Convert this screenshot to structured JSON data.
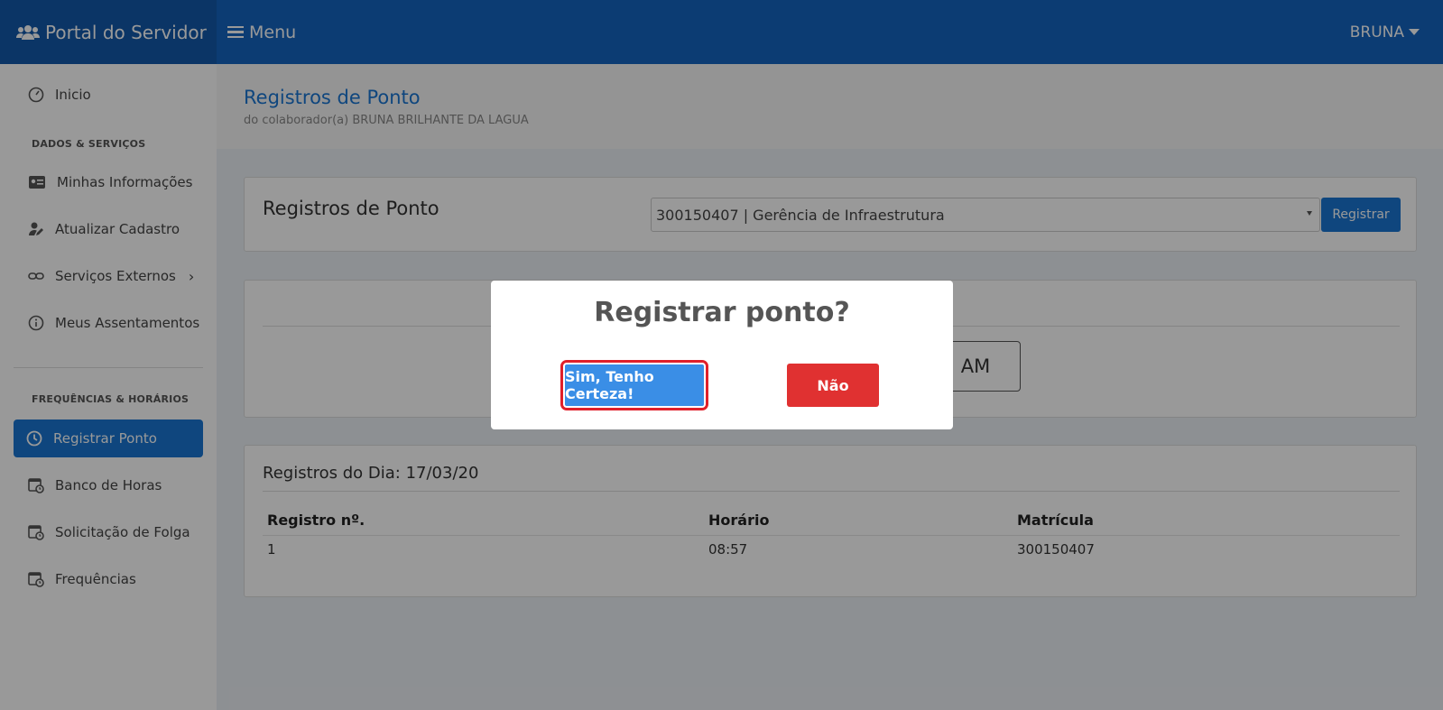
{
  "app": {
    "title": "Portal do Servidor",
    "menu_label": "Menu",
    "user": "BRUNA"
  },
  "sidebar": {
    "inicio": "Inicio",
    "section1": "DADOS & SERVIÇOS",
    "minhas_info": "Minhas Informações",
    "atualizar": "Atualizar Cadastro",
    "servicos": "Serviços Externos",
    "assentamentos": "Meus Assentamentos",
    "section2": "FREQUÊNCIAS & HORÁRIOS",
    "registrar": "Registrar Ponto",
    "banco": "Banco de Horas",
    "folga": "Solicitação de Folga",
    "frequencias": "Frequências"
  },
  "header": {
    "title": "Registros de Ponto",
    "subtitle": "do colaborador(a) BRUNA BRILHANTE DA LAGUA"
  },
  "registro_card": {
    "title": "Registros de Ponto",
    "select_value": "300150407 | Gerência de Infraestrutura",
    "button": "Registrar"
  },
  "clock": {
    "text": "AM"
  },
  "day_card": {
    "title": "Registros do Dia: 17/03/20",
    "columns": [
      "Registro nº.",
      "Horário",
      "Matrícula"
    ],
    "rows": [
      [
        "1",
        "08:57",
        "300150407"
      ]
    ]
  },
  "modal": {
    "title": "Registrar ponto?",
    "confirm": "Sim, Tenho Certeza!",
    "cancel": "Não"
  },
  "colors": {
    "primary": "#1565c0",
    "accent": "#1976d2",
    "danger": "#e03131",
    "confirm": "#3a8ee6"
  }
}
